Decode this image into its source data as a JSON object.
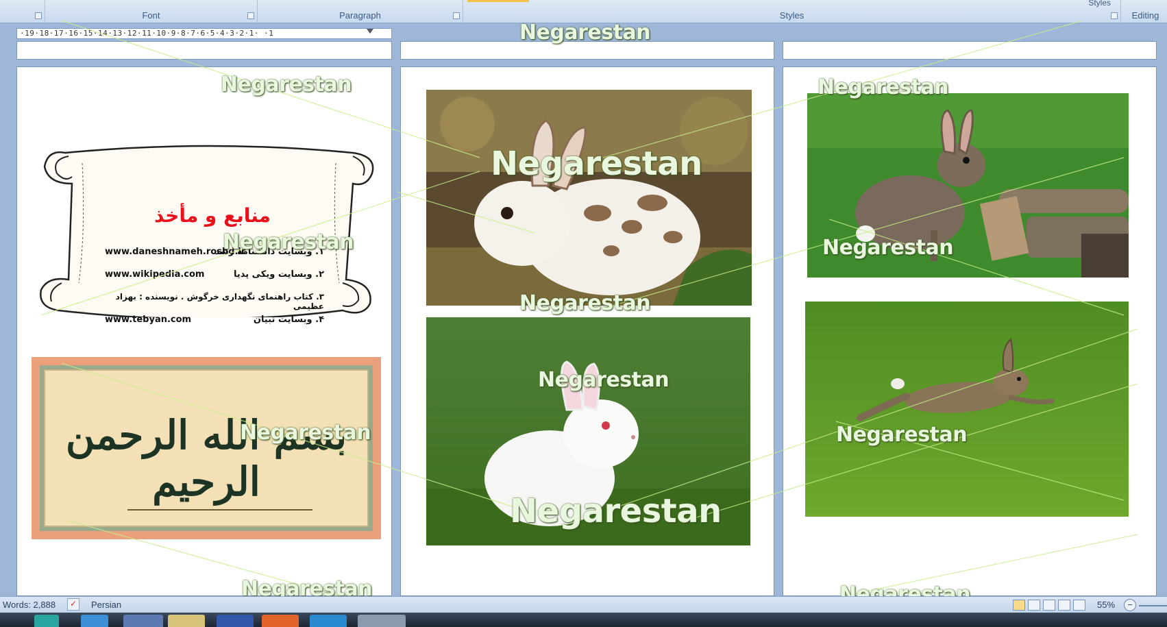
{
  "ribbon": {
    "groups": [
      "Font",
      "Paragraph",
      "Styles",
      "Editing"
    ],
    "styles_button": "Styles"
  },
  "ruler": {
    "text": "·19·18·17·16·15·14·13·12·11·10·9·8·7·6·5·4·3·2·1·   ·1"
  },
  "scroll": {
    "title": "منابع و مأخذ",
    "items": [
      {
        "num": "۱.",
        "label": "وبسایت دانشنامه رشد",
        "url": "www.daneshnameh.roshd.ir"
      },
      {
        "num": "۲.",
        "label": "وبسایت ویکی پدیا",
        "url": "www.wikipedia.com"
      },
      {
        "num": "۳.",
        "label": "کتاب راهنمای نگهداری خرگوش . نویسنده : بهزاد عظیمی",
        "url": ""
      },
      {
        "num": "۴.",
        "label": "وبسایت تبیان",
        "url": "www.tebyan.com"
      }
    ]
  },
  "calligraphy": {
    "text": "بسم الله الرحمن الرحیم"
  },
  "watermark": "Negarestan",
  "status": {
    "words": "Words: 2,888",
    "language": "Persian",
    "zoom": "55%"
  },
  "colors": {
    "title_red": "#e8101a",
    "workspace": "#9eb7d8",
    "cert_border": "#eaa07a"
  }
}
